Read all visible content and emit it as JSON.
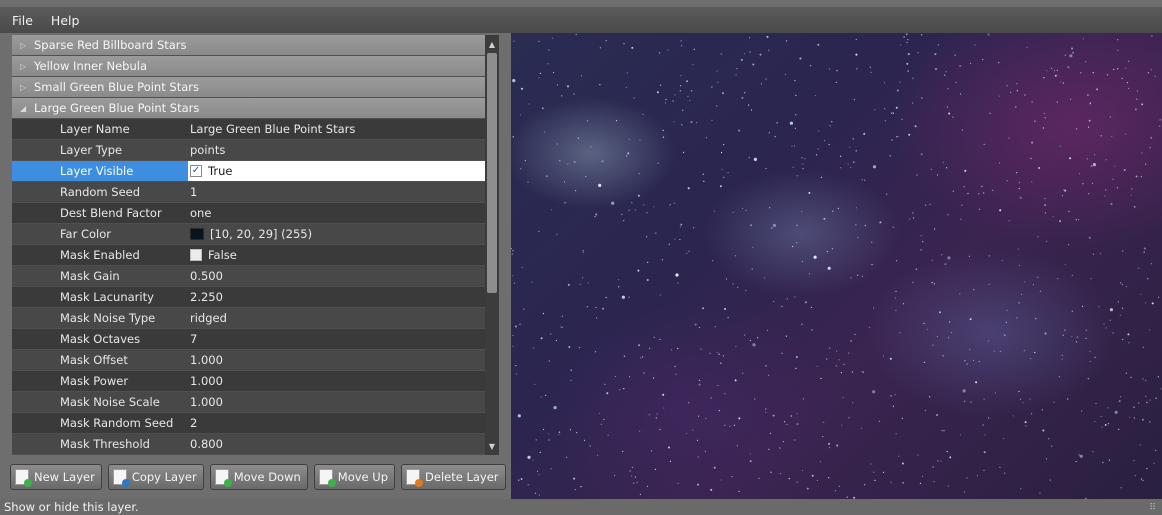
{
  "menu": [
    "File",
    "Help"
  ],
  "groups_top": [
    {
      "label": "Sparse Red Billboard Stars"
    },
    {
      "label": "Yellow Inner Nebula"
    },
    {
      "label": "Small Green Blue Point Stars"
    }
  ],
  "expanded_group": {
    "label": "Large Green Blue Point Stars"
  },
  "properties": [
    {
      "name": "Layer Name",
      "value": "Large Green Blue Point Stars"
    },
    {
      "name": "Layer Type",
      "value": "points"
    },
    {
      "name": "Layer Visible",
      "value": "True",
      "checked": true,
      "selected": true
    },
    {
      "name": "Random Seed",
      "value": "1"
    },
    {
      "name": "Dest Blend Factor",
      "value": "one"
    },
    {
      "name": "Far Color",
      "value": "[10, 20, 29] (255)",
      "swatch": "#0a141d"
    },
    {
      "name": "Mask Enabled",
      "value": "False",
      "checked": false
    },
    {
      "name": "Mask Gain",
      "value": "0.500"
    },
    {
      "name": "Mask Lacunarity",
      "value": "2.250"
    },
    {
      "name": "Mask Noise Type",
      "value": "ridged"
    },
    {
      "name": "Mask Octaves",
      "value": "7"
    },
    {
      "name": "Mask Offset",
      "value": "1.000"
    },
    {
      "name": "Mask Power",
      "value": "1.000"
    },
    {
      "name": "Mask Noise Scale",
      "value": "1.000"
    },
    {
      "name": "Mask Random Seed",
      "value": "2"
    },
    {
      "name": "Mask Threshold",
      "value": "0.800"
    }
  ],
  "buttons": {
    "new_layer": "New Layer",
    "copy_layer": "Copy Layer",
    "move_down": "Move Down",
    "move_up": "Move Up",
    "delete_layer": "Delete Layer"
  },
  "status": "Show or hide this layer.",
  "colors": {
    "selection": "#3d8ee0",
    "badge_green": "#3bb34a",
    "badge_blue": "#2f78c8",
    "badge_orange": "#e07a20"
  }
}
